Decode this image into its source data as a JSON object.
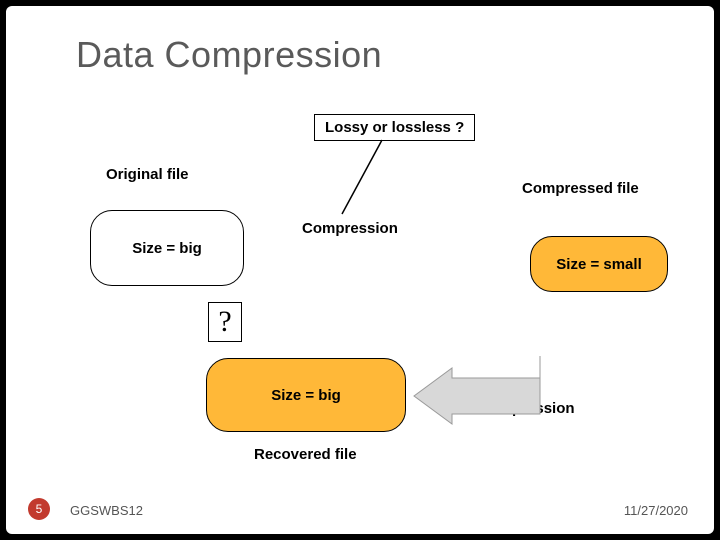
{
  "title": "Data Compression",
  "question_box": "Lossy or lossless ?",
  "labels": {
    "original_file": "Original file",
    "compressed_file": "Compressed file",
    "compression": "Compression",
    "decompression": "Decompression",
    "recovered_file": "Recovered file"
  },
  "shapes": {
    "original_size": "Size = big",
    "compressed_size": "Size = small",
    "recovered_size": "Size = big",
    "question_mark": "?"
  },
  "footer": {
    "slide_number": "5",
    "left": "GGSWBS12",
    "date": "11/27/2020"
  }
}
